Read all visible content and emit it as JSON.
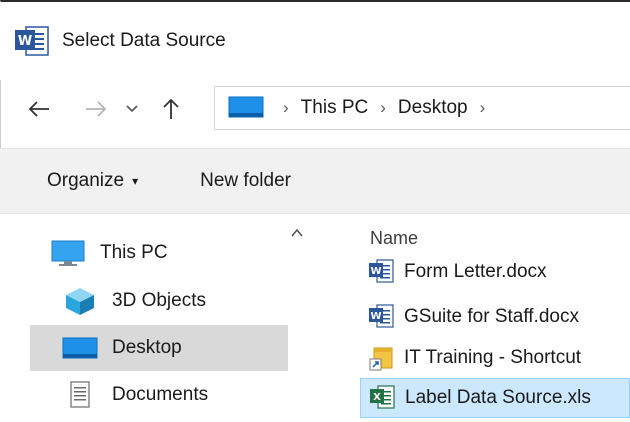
{
  "window": {
    "title": "Select Data Source",
    "app_icon": "word-icon"
  },
  "nav": {
    "back": "back-arrow-icon",
    "forward": "forward-arrow-icon",
    "recent": "chevron-down-icon",
    "up": "up-arrow-icon",
    "breadcrumb": [
      "This PC",
      "Desktop"
    ],
    "separator": "›"
  },
  "toolbar": {
    "organize_label": "Organize",
    "organize_caret": "▾",
    "new_folder_label": "New folder"
  },
  "sidebar": {
    "scroll_up": "^",
    "items": [
      {
        "label": "This PC",
        "icon": "computer-icon"
      },
      {
        "label": "3D Objects",
        "icon": "cube-icon"
      },
      {
        "label": "Desktop",
        "icon": "desktop-icon",
        "selected": true
      },
      {
        "label": "Documents",
        "icon": "document-icon"
      }
    ]
  },
  "filelist": {
    "column_name": "Name",
    "files": [
      {
        "name": "Form Letter.docx",
        "icon": "word-doc-icon"
      },
      {
        "name": "GSuite for Staff.docx",
        "icon": "word-doc-icon"
      },
      {
        "name": "IT Training - Shortcut",
        "icon": "shortcut-icon"
      },
      {
        "name": "Label Data Source.xls",
        "icon": "excel-icon",
        "selected": true
      }
    ]
  },
  "colors": {
    "selection_bg": "#cce8ff",
    "nav_selection_bg": "#d9d9d9",
    "toolbar_bg": "#f1f1f1",
    "word_blue": "#2b579a",
    "excel_green": "#217346"
  }
}
